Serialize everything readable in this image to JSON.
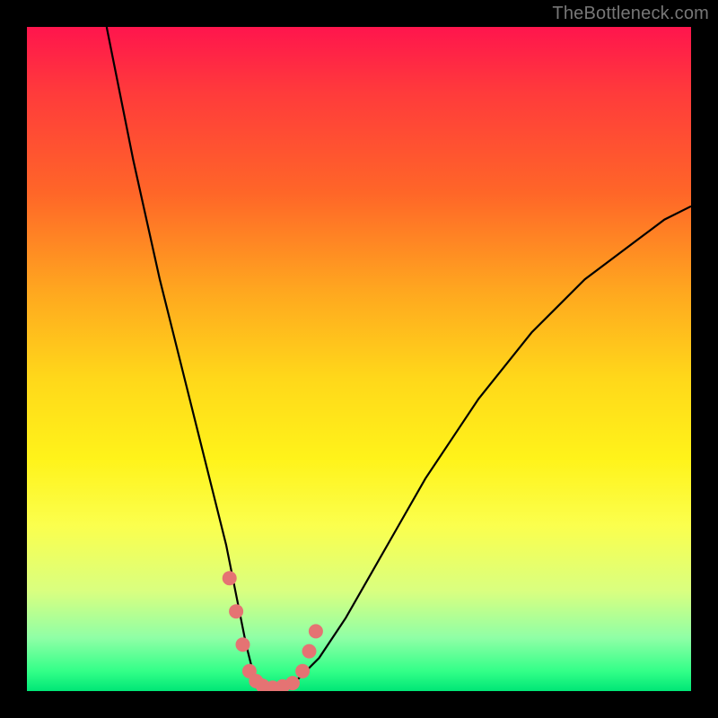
{
  "watermark": "TheBottleneck.com",
  "chart_data": {
    "type": "line",
    "title": "",
    "xlabel": "",
    "ylabel": "",
    "xlim": [
      0,
      100
    ],
    "ylim": [
      0,
      100
    ],
    "series": [
      {
        "name": "bottleneck-curve",
        "x": [
          12,
          14,
          16,
          18,
          20,
          22,
          24,
          26,
          28,
          30,
          31,
          32,
          33,
          34,
          35,
          36,
          38,
          40,
          44,
          48,
          52,
          56,
          60,
          64,
          68,
          72,
          76,
          80,
          84,
          88,
          92,
          96,
          100
        ],
        "y": [
          100,
          90,
          80,
          71,
          62,
          54,
          46,
          38,
          30,
          22,
          17,
          12,
          7,
          3,
          1,
          0,
          0,
          1,
          5,
          11,
          18,
          25,
          32,
          38,
          44,
          49,
          54,
          58,
          62,
          65,
          68,
          71,
          73
        ]
      }
    ],
    "markers": {
      "name": "highlight-dots",
      "color": "#e57373",
      "points": [
        {
          "x": 30.5,
          "y": 17
        },
        {
          "x": 31.5,
          "y": 12
        },
        {
          "x": 32.5,
          "y": 7
        },
        {
          "x": 33.5,
          "y": 3
        },
        {
          "x": 34.5,
          "y": 1.5
        },
        {
          "x": 35.5,
          "y": 0.8
        },
        {
          "x": 37.0,
          "y": 0.5
        },
        {
          "x": 38.5,
          "y": 0.7
        },
        {
          "x": 40.0,
          "y": 1.2
        },
        {
          "x": 41.5,
          "y": 3
        },
        {
          "x": 42.5,
          "y": 6
        },
        {
          "x": 43.5,
          "y": 9
        }
      ]
    },
    "colors": {
      "curve": "#000000",
      "marker": "#e57373",
      "background_top": "#ff154d",
      "background_bottom": "#00e676",
      "frame": "#000000"
    }
  }
}
